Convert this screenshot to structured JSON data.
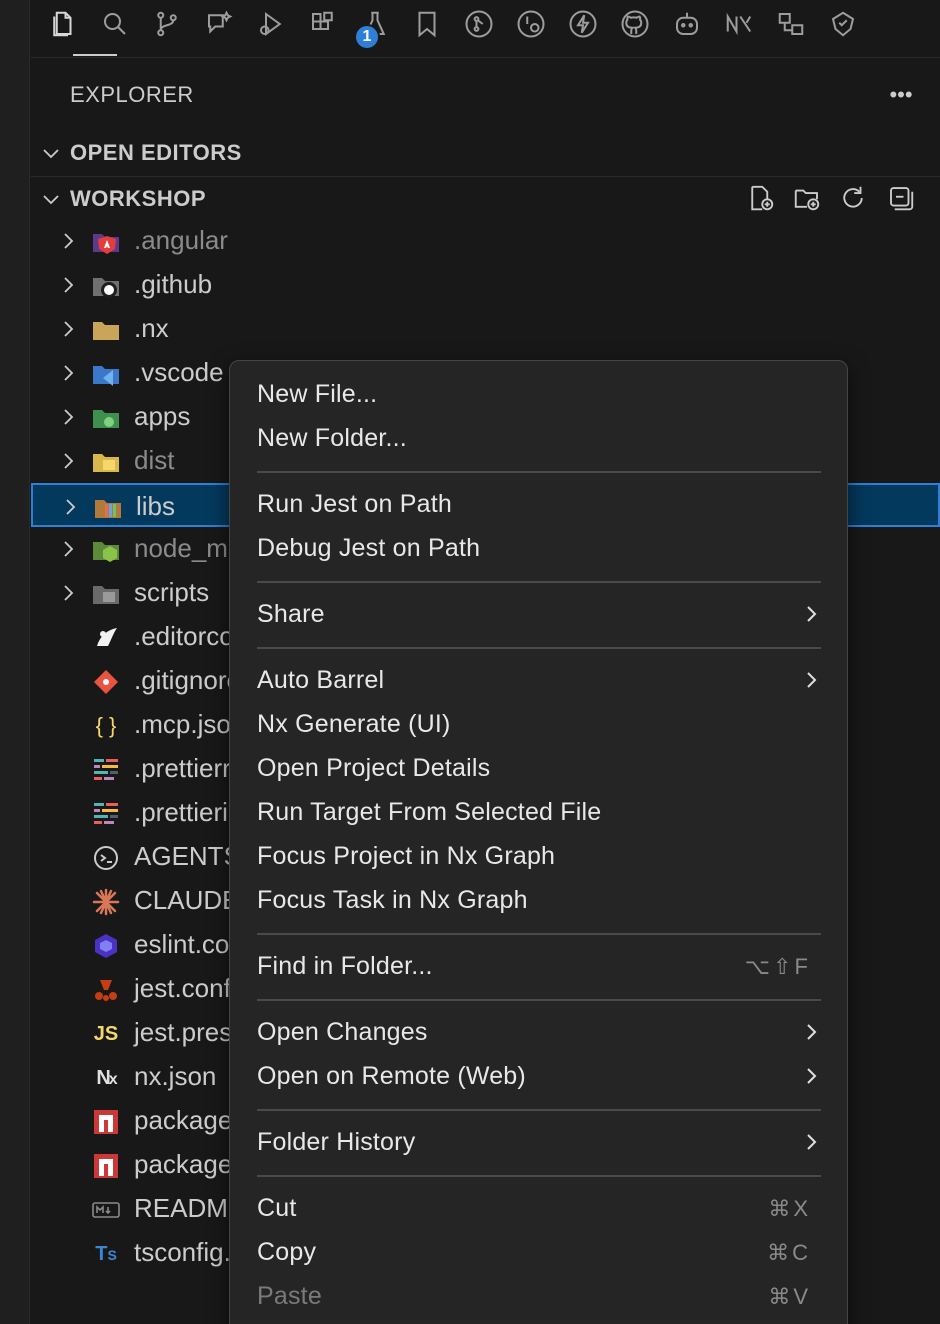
{
  "activity_bar": {
    "icons": [
      "explorer-icon",
      "search-icon",
      "source-control-icon",
      "chat-sparkle-icon",
      "run-debug-icon",
      "extensions-icon",
      "testing-icon",
      "bookmark-icon",
      "git-graph-icon",
      "git-history-icon",
      "lightning-icon",
      "github-icon",
      "copilot-icon",
      "nx-console-icon",
      "remote-explorer-icon",
      "gitlens-icon"
    ],
    "extensions_badge": "1"
  },
  "explorer": {
    "title": "EXPLORER",
    "open_editors_label": "OPEN EDITORS",
    "workspace_label": "WORKSHOP",
    "workspace_actions": [
      "new-file-icon",
      "new-folder-icon",
      "refresh-icon",
      "collapse-all-icon"
    ]
  },
  "tree": [
    {
      "name": ".angular",
      "folder": true,
      "dim": true,
      "icon": "angular-folder-icon"
    },
    {
      "name": ".github",
      "folder": true,
      "dim": false,
      "icon": "github-folder-icon"
    },
    {
      "name": ".nx",
      "folder": true,
      "dim": false,
      "icon": "folder-icon"
    },
    {
      "name": ".vscode",
      "folder": true,
      "dim": false,
      "icon": "vscode-folder-icon"
    },
    {
      "name": "apps",
      "folder": true,
      "dim": false,
      "icon": "apps-folder-icon"
    },
    {
      "name": "dist",
      "folder": true,
      "dim": true,
      "icon": "dist-folder-icon"
    },
    {
      "name": "libs",
      "folder": true,
      "dim": false,
      "selected": true,
      "icon": "libs-folder-icon"
    },
    {
      "name": "node_modules",
      "folder": true,
      "dim": true,
      "icon": "node-folder-icon"
    },
    {
      "name": "scripts",
      "folder": true,
      "dim": false,
      "icon": "scripts-folder-icon"
    },
    {
      "name": ".editorconfig",
      "folder": false,
      "dim": false,
      "icon": "editorconfig-icon"
    },
    {
      "name": ".gitignore",
      "folder": false,
      "dim": false,
      "icon": "git-icon"
    },
    {
      "name": ".mcp.json",
      "folder": false,
      "dim": false,
      "icon": "json-icon"
    },
    {
      "name": ".prettierrc",
      "folder": false,
      "dim": false,
      "icon": "prettier-icon"
    },
    {
      "name": ".prettierignore",
      "folder": false,
      "dim": false,
      "icon": "prettier-icon"
    },
    {
      "name": "AGENTS.md",
      "folder": false,
      "dim": false,
      "icon": "agents-icon"
    },
    {
      "name": "CLAUDE.md",
      "folder": false,
      "dim": false,
      "icon": "claude-icon"
    },
    {
      "name": "eslint.config.mjs",
      "folder": false,
      "dim": false,
      "icon": "eslint-icon"
    },
    {
      "name": "jest.config.ts",
      "folder": false,
      "dim": false,
      "icon": "jest-icon"
    },
    {
      "name": "jest.preset.js",
      "folder": false,
      "dim": false,
      "icon": "js-icon"
    },
    {
      "name": "nx.json",
      "folder": false,
      "dim": false,
      "icon": "nx-icon"
    },
    {
      "name": "package.json",
      "folder": false,
      "dim": false,
      "icon": "npm-icon"
    },
    {
      "name": "package-lock.json",
      "folder": false,
      "dim": false,
      "icon": "npm-icon"
    },
    {
      "name": "README.md",
      "folder": false,
      "dim": false,
      "icon": "markdown-icon"
    },
    {
      "name": "tsconfig.base.json",
      "folder": false,
      "dim": false,
      "icon": "ts-icon"
    }
  ],
  "context_menu": {
    "items": [
      {
        "label": "New File...",
        "kind": "item"
      },
      {
        "label": "New Folder...",
        "kind": "item"
      },
      {
        "kind": "sep"
      },
      {
        "label": "Run Jest on Path",
        "kind": "item"
      },
      {
        "label": "Debug Jest on Path",
        "kind": "item"
      },
      {
        "kind": "sep"
      },
      {
        "label": "Share",
        "kind": "submenu"
      },
      {
        "kind": "sep"
      },
      {
        "label": "Auto Barrel",
        "kind": "submenu"
      },
      {
        "label": "Nx Generate (UI)",
        "kind": "item"
      },
      {
        "label": "Open Project Details",
        "kind": "item"
      },
      {
        "label": "Run Target From Selected File",
        "kind": "item"
      },
      {
        "label": "Focus Project in Nx Graph",
        "kind": "item"
      },
      {
        "label": "Focus Task in Nx Graph",
        "kind": "item"
      },
      {
        "kind": "sep"
      },
      {
        "label": "Find in Folder...",
        "kind": "item",
        "shortcut": "⌥⇧F"
      },
      {
        "kind": "sep"
      },
      {
        "label": "Open Changes",
        "kind": "submenu"
      },
      {
        "label": "Open on Remote (Web)",
        "kind": "submenu"
      },
      {
        "kind": "sep"
      },
      {
        "label": "Folder History",
        "kind": "submenu"
      },
      {
        "kind": "sep"
      },
      {
        "label": "Cut",
        "kind": "item",
        "shortcut": "⌘X"
      },
      {
        "label": "Copy",
        "kind": "item",
        "shortcut": "⌘C"
      },
      {
        "label": "Paste",
        "kind": "item",
        "shortcut": "⌘V",
        "disabled": true
      }
    ]
  },
  "colors": {
    "selection_bg": "#04395e",
    "selection_border": "#2f7fd6",
    "badge": "#2f7fd6"
  }
}
